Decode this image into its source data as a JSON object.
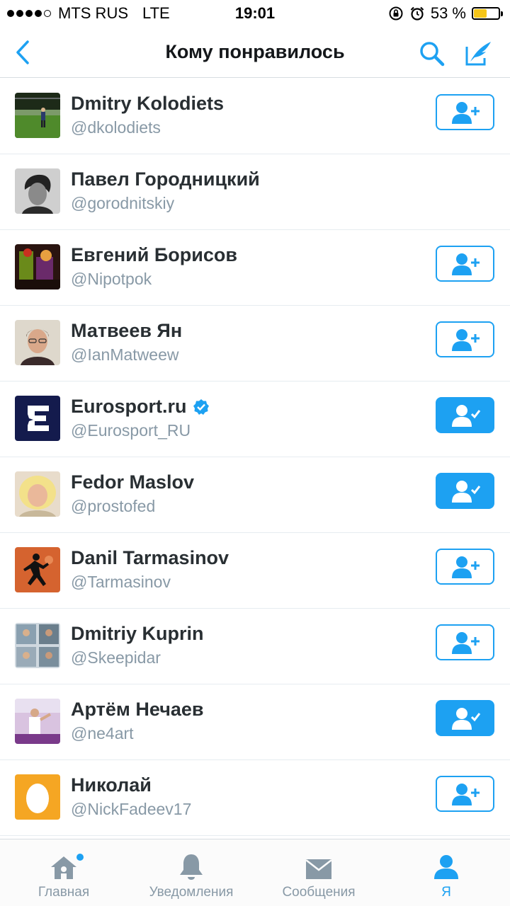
{
  "status_bar": {
    "carrier": "MTS RUS",
    "network": "LTE",
    "time": "19:01",
    "battery_percent": "53 %",
    "battery_level": 0.53
  },
  "nav": {
    "title": "Кому понравилось"
  },
  "users": [
    {
      "name": "Dmitry Kolodiets",
      "handle": "@dkolodiets",
      "state": "follow",
      "verified": false
    },
    {
      "name": "Павел Городницкий",
      "handle": "@gorodnitskiy",
      "state": "none",
      "verified": false
    },
    {
      "name": "Евгений Борисов",
      "handle": "@Nipotpok",
      "state": "follow",
      "verified": false
    },
    {
      "name": "Матвеев Ян",
      "handle": "@IanMatweew",
      "state": "follow",
      "verified": false
    },
    {
      "name": "Eurosport.ru",
      "handle": "@Eurosport_RU",
      "state": "following",
      "verified": true
    },
    {
      "name": "Fedor Maslov",
      "handle": "@prostofed",
      "state": "following",
      "verified": false
    },
    {
      "name": "Danil Tarmasinov",
      "handle": "@Tarmasinov",
      "state": "follow",
      "verified": false
    },
    {
      "name": "Dmitriy Kuprin",
      "handle": "@Skeepidar",
      "state": "follow",
      "verified": false
    },
    {
      "name": "Артём Нечаев",
      "handle": "@ne4art",
      "state": "following",
      "verified": false
    },
    {
      "name": "Николай",
      "handle": "@NickFadeev17",
      "state": "follow",
      "verified": false
    }
  ],
  "tabs": [
    {
      "label": "Главная",
      "icon": "home-icon",
      "active": false,
      "badge": true
    },
    {
      "label": "Уведомления",
      "icon": "bell-icon",
      "active": false,
      "badge": false
    },
    {
      "label": "Сообщения",
      "icon": "envelope-icon",
      "active": false,
      "badge": false
    },
    {
      "label": "Я",
      "icon": "profile-icon",
      "active": true,
      "badge": false
    }
  ],
  "colors": {
    "accent": "#1da1f2",
    "text_primary": "#292f33",
    "text_secondary": "#8899a6",
    "inactive_icon": "#8899a6"
  }
}
